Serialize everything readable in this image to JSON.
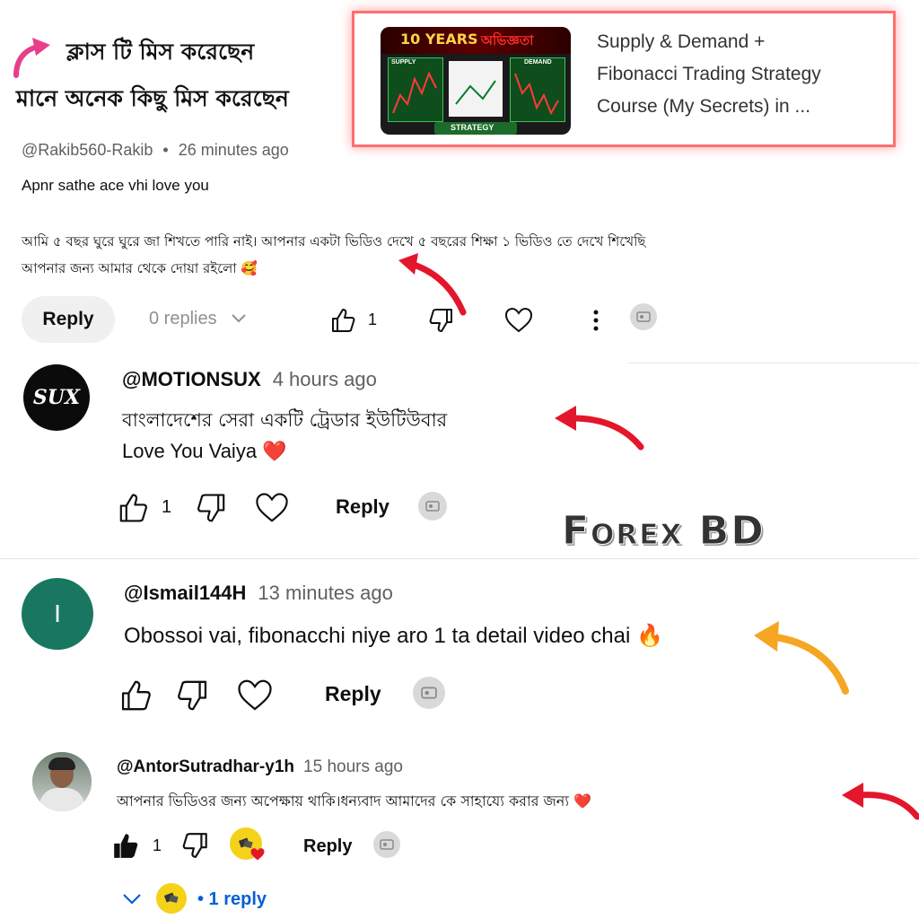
{
  "colors": {
    "accent_red": "#e3162b",
    "accent_orange": "#f5a623",
    "accent_pink": "#e83e8c",
    "avatar_green": "#197761",
    "avatar_black": "#0b0b0b",
    "card_border": "#ff6f6f"
  },
  "banner": {
    "headline_line1": "ক্লাস টি মিস করেছেন",
    "headline_line2": "মানে অনেক কিছু মিস করেছেন",
    "arrow_icon": "curved-arrow-icon"
  },
  "video_card": {
    "thumb_years": "10 YEARS",
    "thumb_bangla": "অভিজ্ঞতা",
    "thumb_supply": "SUPPLY",
    "thumb_demand": "DEMAND",
    "thumb_strategy": "STRATEGY",
    "title_line1": "Supply & Demand +",
    "title_line2": "Fibonacci Trading Strategy",
    "title_line3": "Course (My Secrets) in ..."
  },
  "comment1": {
    "handle": "@Rakib560-Rakib",
    "separator": "•",
    "time": "26 minutes ago",
    "line1": "Apnr sathe ace vhi love you",
    "line2": "আমি ৫ বছর ঘুরে ঘুরে জা শিখতে পারি নাই। আপনার একটা ভিডিও দেখে ৫ বছরের শিক্ষা ১ ভিডিও তে দেখে শিখেছি",
    "line3": "আপনার জন্য আমার থেকে দোয়া রইলো 🥰",
    "reply_label": "Reply",
    "replies_label": "0 replies",
    "like_count": "1"
  },
  "comment2": {
    "avatar_text": "SUX",
    "handle": "@MOTIONSUX",
    "time": "4 hours ago",
    "line1": "বাংলাদেশের সেরা একটি ট্রেডার ইউটিউবার",
    "line2": "Love You Vaiya ❤️",
    "like_count": "1",
    "reply_label": "Reply"
  },
  "watermark": {
    "text": "Forex BD"
  },
  "comment3": {
    "avatar_letter": "I",
    "handle": "@Ismail144H",
    "time": "13 minutes ago",
    "line1": "Obossoi vai, fibonacchi niye aro 1 ta detail video chai 🔥",
    "reply_label": "Reply"
  },
  "comment4": {
    "handle": "@AntorSutradhar-y1h",
    "time": "15 hours ago",
    "line1": "আপনার ভিডিওর জন্য অপেক্ষায় থাকি।ধন্যবাদ আমাদের কে সাহায্যে করার জন্য ❤️",
    "like_count": "1",
    "reply_label": "Reply",
    "replies_label": "• 1 reply"
  }
}
